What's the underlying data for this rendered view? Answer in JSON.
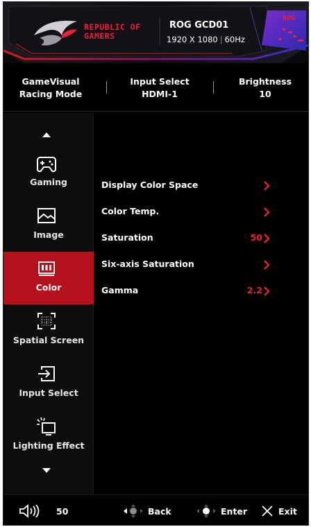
{
  "header": {
    "brand_line1": "REPUBLIC OF",
    "brand_line2": "GAMERS",
    "model": "ROG GCD01",
    "resolution": "1920 X 1080",
    "refresh": "60Hz",
    "badge_text": "ROG",
    "accent_color": "#e8203a"
  },
  "status": {
    "gamevisual": {
      "label": "GameVisual",
      "value": "Racing Mode"
    },
    "input": {
      "label": "Input Select",
      "value": "HDMI-1"
    },
    "brightness": {
      "label": "Brightness",
      "value": "10"
    }
  },
  "sidebar": {
    "up_icon": "triangle-up-icon",
    "down_icon": "triangle-down-icon",
    "active_color": "#b4111c",
    "items": [
      {
        "label": "Gaming",
        "icon": "gamepad-icon"
      },
      {
        "label": "Image",
        "icon": "image-icon"
      },
      {
        "label": "Color",
        "icon": "color-bars-icon",
        "active": true
      },
      {
        "label": "Spatial Screen",
        "icon": "spatial-screen-icon"
      },
      {
        "label": "Input Select",
        "icon": "input-select-icon"
      },
      {
        "label": "Lighting Effect",
        "icon": "lighting-effect-icon"
      }
    ]
  },
  "menu": {
    "rows": [
      {
        "label": "Display Color Space",
        "value": ""
      },
      {
        "label": "Color Temp.",
        "value": ""
      },
      {
        "label": "Saturation",
        "value": "50"
      },
      {
        "label": "Six-axis Saturation",
        "value": ""
      },
      {
        "label": "Gamma",
        "value": "2.2"
      }
    ]
  },
  "footer": {
    "volume_icon": "speaker-icon",
    "volume": "50",
    "back": "Back",
    "enter": "Enter",
    "exit": "Exit"
  }
}
